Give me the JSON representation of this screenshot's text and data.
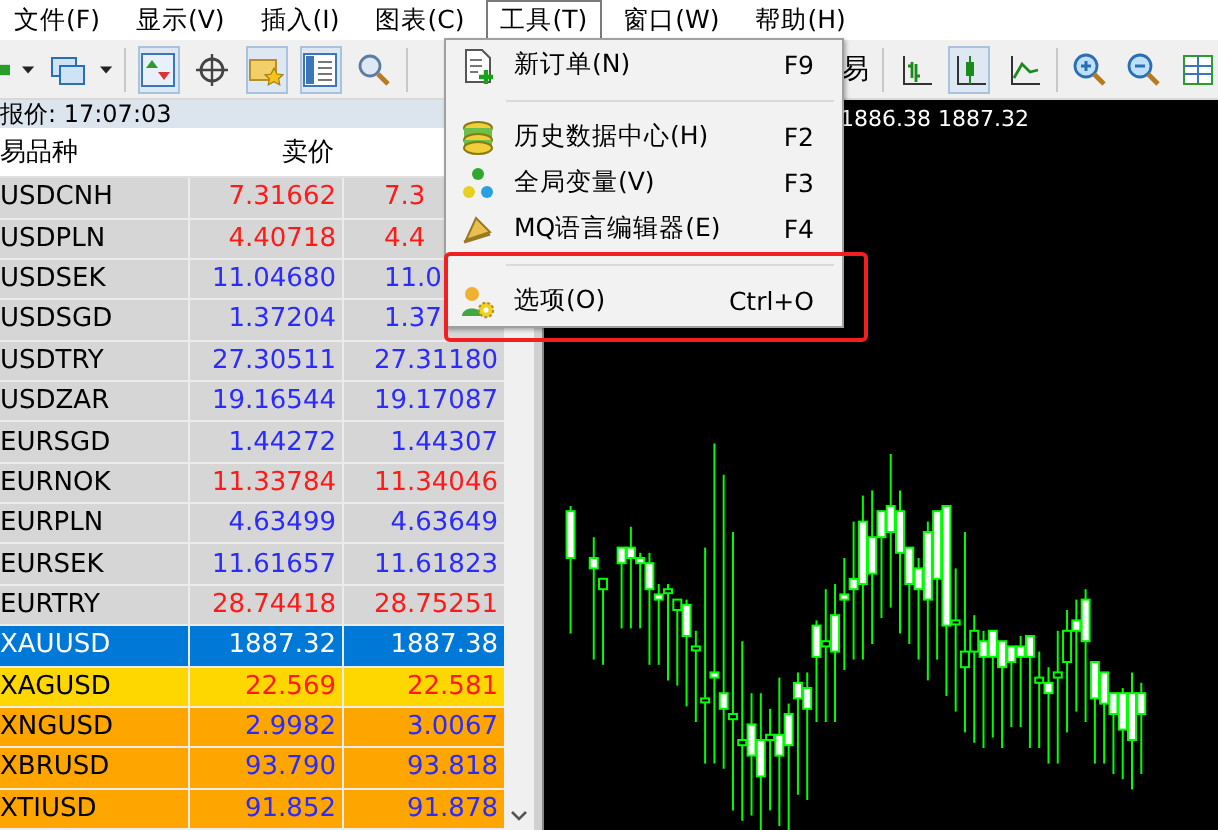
{
  "menu_bar": [
    {
      "label": "文件(F)",
      "selected": false
    },
    {
      "label": "显示(V)",
      "selected": false
    },
    {
      "label": "插入(I)",
      "selected": false
    },
    {
      "label": "图表(C)",
      "selected": false
    },
    {
      "label": "工具(T)",
      "selected": true
    },
    {
      "label": "窗口(W)",
      "selected": false
    },
    {
      "label": "帮助(H)",
      "selected": false
    }
  ],
  "toolbar": {
    "trade_label": "易"
  },
  "market_watch": {
    "title": "报价: 17:07:03",
    "columns": [
      "易品种",
      "卖价"
    ],
    "rows": [
      {
        "symbol": "USDCNH",
        "bid": "7.31662",
        "ask": "7.3",
        "color": "#ff1a1a",
        "kind": "forex",
        "selected": false,
        "partial": true
      },
      {
        "symbol": "USDPLN",
        "bid": "4.40718",
        "ask": "4.4",
        "color": "#ff1a1a",
        "kind": "forex",
        "selected": false,
        "partial": true
      },
      {
        "symbol": "USDSEK",
        "bid": "11.04680",
        "ask": "11.0",
        "color": "#2b2bff",
        "kind": "forex",
        "selected": false,
        "partial": true
      },
      {
        "symbol": "USDSGD",
        "bid": "1.37204",
        "ask": "1.37",
        "color": "#2b2bff",
        "kind": "forex",
        "selected": false,
        "partial": true
      },
      {
        "symbol": "USDTRY",
        "bid": "27.30511",
        "ask": "27.31180",
        "color": "#2b2bff",
        "kind": "forex",
        "selected": false,
        "partial": false
      },
      {
        "symbol": "USDZAR",
        "bid": "19.16544",
        "ask": "19.17087",
        "color": "#2b2bff",
        "kind": "forex",
        "selected": false,
        "partial": false
      },
      {
        "symbol": "EURSGD",
        "bid": "1.44272",
        "ask": "1.44307",
        "color": "#2b2bff",
        "kind": "forex",
        "selected": false,
        "partial": false
      },
      {
        "symbol": "EURNOK",
        "bid": "11.33784",
        "ask": "11.34046",
        "color": "#ff1a1a",
        "kind": "forex",
        "selected": false,
        "partial": false
      },
      {
        "symbol": "EURPLN",
        "bid": "4.63499",
        "ask": "4.63649",
        "color": "#2b2bff",
        "kind": "forex",
        "selected": false,
        "partial": false
      },
      {
        "symbol": "EURSEK",
        "bid": "11.61657",
        "ask": "11.61823",
        "color": "#2b2bff",
        "kind": "forex",
        "selected": false,
        "partial": false
      },
      {
        "symbol": "EURTRY",
        "bid": "28.74418",
        "ask": "28.75251",
        "color": "#ff1a1a",
        "kind": "forex",
        "selected": false,
        "partial": false
      },
      {
        "symbol": "XAUUSD",
        "bid": "1887.32",
        "ask": "1887.38",
        "color": "#ffffff",
        "kind": "metal",
        "selected": true,
        "partial": false
      },
      {
        "symbol": "XAGUSD",
        "bid": "22.569",
        "ask": "22.581",
        "color": "#ff1a1a",
        "kind": "metal",
        "selected": false,
        "partial": false
      },
      {
        "symbol": "XNGUSD",
        "bid": "2.9982",
        "ask": "3.0067",
        "color": "#2b2bff",
        "kind": "energy",
        "selected": false,
        "partial": false
      },
      {
        "symbol": "XBRUSD",
        "bid": "93.790",
        "ask": "93.818",
        "color": "#2b2bff",
        "kind": "energy",
        "selected": false,
        "partial": false
      },
      {
        "symbol": "XTIUSD",
        "bid": "91.852",
        "ask": "91.878",
        "color": "#2b2bff",
        "kind": "energy",
        "selected": false,
        "partial": false
      }
    ]
  },
  "chart": {
    "price_label": "1886.38 1887.32"
  },
  "tools_menu": {
    "items": [
      {
        "kind": "item",
        "label": "新订单(N)",
        "shortcut": "F9"
      },
      {
        "kind": "separator"
      },
      {
        "kind": "item",
        "label": "历史数据中心(H)",
        "shortcut": "F2"
      },
      {
        "kind": "item",
        "label": "全局变量(V)",
        "shortcut": "F3"
      },
      {
        "kind": "item",
        "label": "MQ语言编辑器(E)",
        "shortcut": "F4"
      },
      {
        "kind": "separator"
      },
      {
        "kind": "item",
        "label": "选项(O)",
        "shortcut": "Ctrl+O"
      }
    ]
  }
}
